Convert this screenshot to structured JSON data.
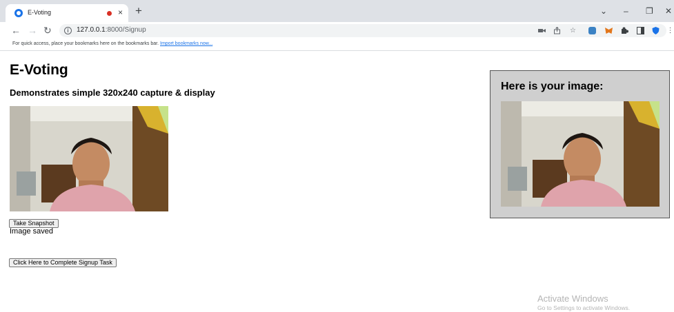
{
  "browser": {
    "tab_title": "E-Voting",
    "tab_close": "×",
    "new_tab": "+",
    "window_controls": {
      "collapse": "⌄",
      "minimize": "–",
      "restore": "❐",
      "close": "✕"
    },
    "nav": {
      "back": "←",
      "forward": "→",
      "reload": "↻"
    },
    "url_host": "127.0.0.1",
    "url_path": ":8000/Signup",
    "bookmarks_text": "For quick access, place your bookmarks here on the bookmarks bar.",
    "bookmarks_link": "Import bookmarks now..."
  },
  "page": {
    "title": "E-Voting",
    "subtitle": "Demonstrates simple 320x240 capture & display",
    "snapshot_button": "Take Snapshot",
    "status_text": "Image saved",
    "signup_button": "Click Here to Complete Signup Task",
    "result_title": "Here is your image:"
  },
  "os_watermark": {
    "title": "Activate Windows",
    "subtitle": "Go to Settings to activate Windows."
  },
  "colors": {
    "tab_strip": "#dee1e6",
    "omnibox": "#f1f3f4",
    "result_panel": "#cfcfcf",
    "link": "#1a73e8",
    "recording_dot": "#d93025"
  },
  "icons": {
    "toolbar": [
      "video-camera-icon",
      "share-icon",
      "star-icon",
      "adblock-icon",
      "metamask-fox-icon",
      "puzzle-extensions-icon",
      "side-panel-icon",
      "shield-icon",
      "kebab-menu-icon"
    ]
  }
}
